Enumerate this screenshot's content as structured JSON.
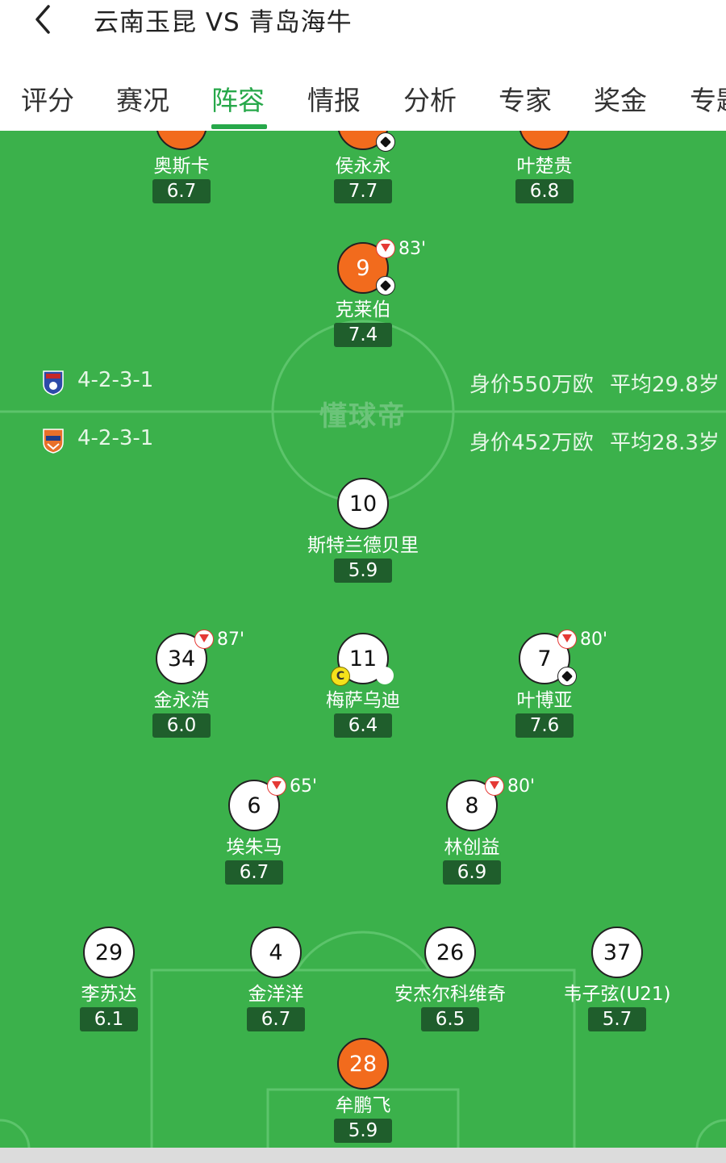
{
  "header": {
    "title": "云南玉昆 VS 青岛海牛"
  },
  "tabs": [
    {
      "label": "评分"
    },
    {
      "label": "赛况"
    },
    {
      "label": "阵容"
    },
    {
      "label": "情报"
    },
    {
      "label": "分析"
    },
    {
      "label": "专家"
    },
    {
      "label": "奖金"
    },
    {
      "label": "专题"
    }
  ],
  "active_tab": "阵容",
  "colors": {
    "accent": "#27a84a",
    "pitch": "#3bb14b",
    "home_disc": "#f26b1d",
    "rating_bg": "#1f5e2c"
  },
  "watermark": "懂球帝",
  "home_team": {
    "formation": "4-2-3-1",
    "value": "身价550万欧",
    "avg_age": "平均29.8岁"
  },
  "away_team": {
    "formation": "4-2-3-1",
    "value": "身价452万欧",
    "avg_age": "平均28.3岁"
  },
  "home_players": [
    {
      "name": "奥斯卡",
      "rating": "6.7"
    },
    {
      "name": "侯永永",
      "rating": "7.7"
    },
    {
      "name": "叶楚贵",
      "rating": "6.8"
    },
    {
      "number": "9",
      "name": "克莱伯",
      "rating": "7.4",
      "sub_minute": "83'"
    }
  ],
  "away_players": [
    {
      "number": "10",
      "name": "斯特兰德贝里",
      "rating": "5.9"
    },
    {
      "number": "34",
      "name": "金永浩",
      "rating": "6.0",
      "sub_minute": "87'"
    },
    {
      "number": "11",
      "name": "梅萨乌迪",
      "rating": "6.4",
      "card": "C"
    },
    {
      "number": "7",
      "name": "叶博亚",
      "rating": "7.6",
      "sub_minute": "80'"
    },
    {
      "number": "6",
      "name": "埃朱马",
      "rating": "6.7",
      "sub_minute": "65'"
    },
    {
      "number": "8",
      "name": "林创益",
      "rating": "6.9",
      "sub_minute": "80'"
    },
    {
      "number": "29",
      "name": "李苏达",
      "rating": "6.1"
    },
    {
      "number": "4",
      "name": "金洋洋",
      "rating": "6.7"
    },
    {
      "number": "26",
      "name": "安杰尔科维奇",
      "rating": "6.5"
    },
    {
      "number": "37",
      "name": "韦子弦(U21)",
      "rating": "5.7"
    },
    {
      "number": "28",
      "name": "牟鹏飞",
      "rating": "5.9"
    }
  ]
}
